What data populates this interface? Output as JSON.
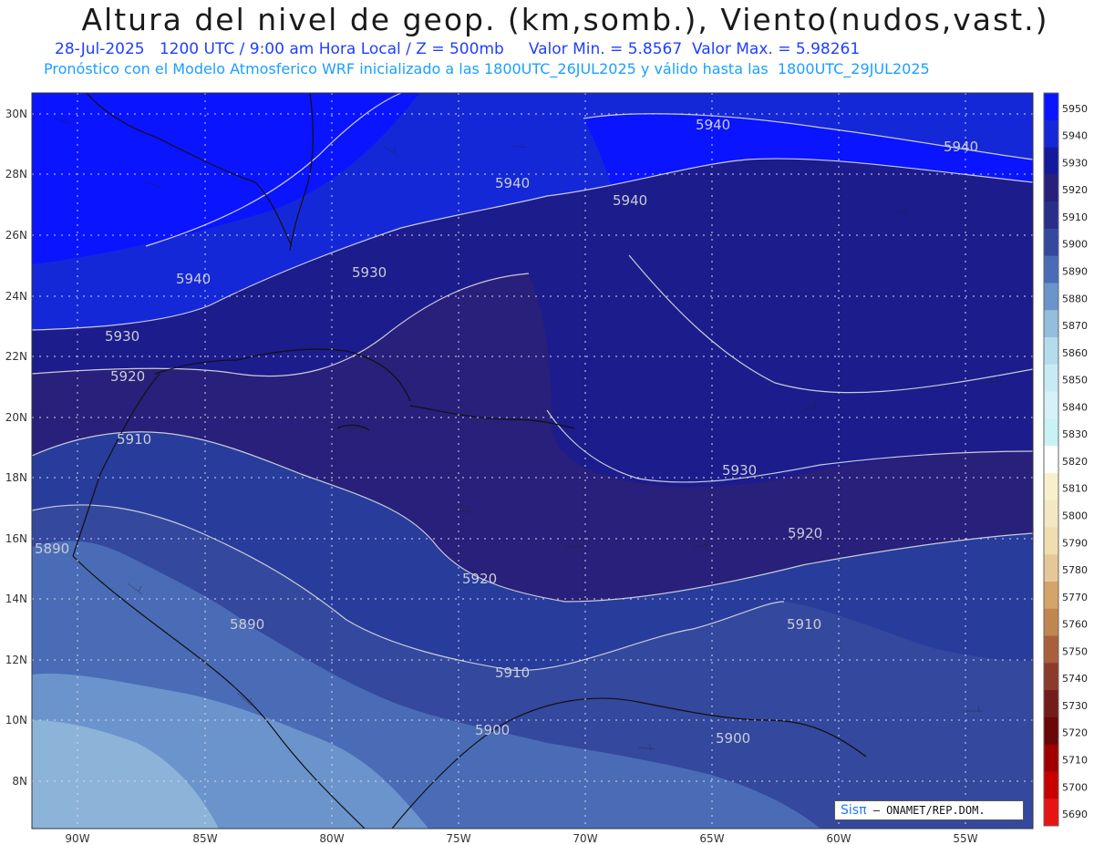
{
  "header": {
    "title": "Altura del nivel de geop. (km,somb.), Viento(nudos,vast.)",
    "date": "28-Jul-2025",
    "time": "1200 UTC / 9:00 am Hora Local / Z = 500mb",
    "min_label": "Valor Min. = 5.8567",
    "max_label": "Valor Max. = 5.98261",
    "model_line": "Pronóstico con el Modelo Atmosferico WRF inicializado a las 1800UTC_26JUL2025 y válido hasta las  1800UTC_29JUL2025"
  },
  "map": {
    "variable": "Geopotential height 500mb (m)",
    "extent": {
      "lon": [
        -92,
        -52
      ],
      "lat": [
        6.5,
        31
      ]
    },
    "lat_ticks": [
      "30N",
      "28N",
      "26N",
      "24N",
      "22N",
      "20N",
      "18N",
      "16N",
      "14N",
      "12N",
      "10N",
      "8N"
    ],
    "lon_ticks": [
      "90W",
      "85W",
      "80W",
      "75W",
      "70W",
      "65W",
      "60W",
      "55W"
    ],
    "contour_labels": [
      "5940",
      "5940",
      "5940",
      "5940",
      "5940",
      "5930",
      "5930",
      "5930",
      "5920",
      "5920",
      "5920",
      "5910",
      "5910",
      "5910",
      "5900",
      "5900",
      "5890",
      "5890"
    ],
    "colors": {
      "c5950": "#0a14ff",
      "c5940": "#1428d8",
      "c5930": "#1c1c8c",
      "c5920": "#28207a",
      "c5910": "#283c9c",
      "c5900": "#3a5aa8",
      "c5890": "#5a84c0",
      "c5880": "#8cb4d8"
    }
  },
  "colorbar": {
    "levels": [
      "5950",
      "5940",
      "5930",
      "5920",
      "5910",
      "5900",
      "5890",
      "5880",
      "5870",
      "5860",
      "5850",
      "5840",
      "5830",
      "5820",
      "5810",
      "5800",
      "5790",
      "5780",
      "5770",
      "5760",
      "5750",
      "5740",
      "5730",
      "5720",
      "5710",
      "5700",
      "5690"
    ],
    "colors": [
      "#0a14ff",
      "#1428d8",
      "#141a9c",
      "#28207a",
      "#2a2e8a",
      "#34489e",
      "#4a6cb6",
      "#6c94cc",
      "#94bede",
      "#b4dcec",
      "#c8eaf4",
      "#d6f2f8",
      "#c9f2f6",
      "#ffffff",
      "#f8f0cc",
      "#f4e8c4",
      "#f0deb0",
      "#e6c898",
      "#d4a468",
      "#c08650",
      "#a8603c",
      "#8c3a2a",
      "#741c1c",
      "#6a0808",
      "#a00000",
      "#c80000",
      "#e81414"
    ]
  },
  "credit": {
    "logo": "Sisπ",
    "text": "– ONAMET/REP.DOM."
  }
}
